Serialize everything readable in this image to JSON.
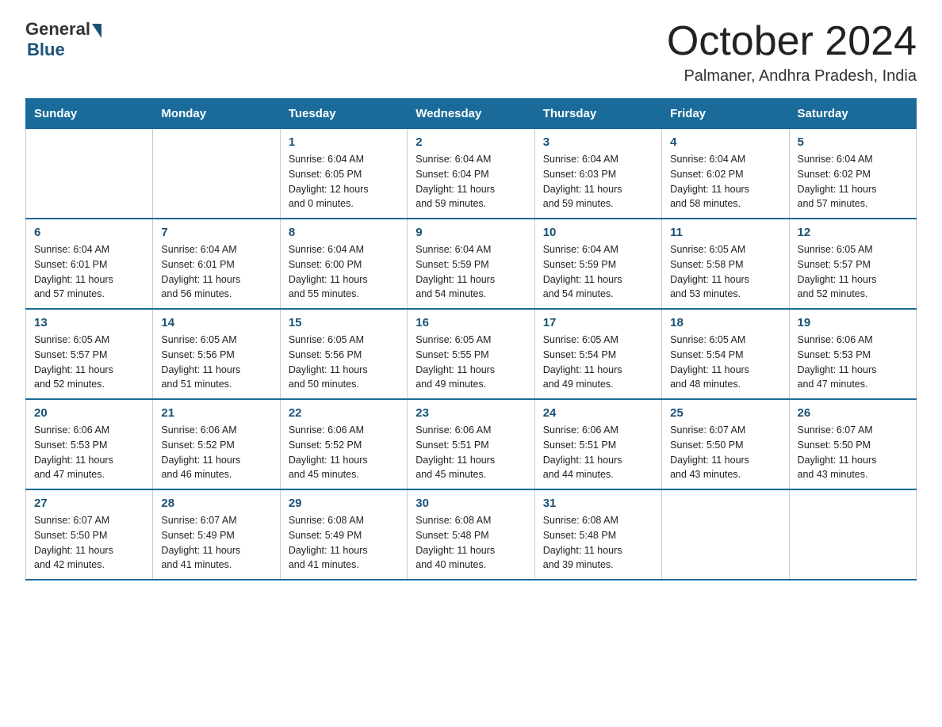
{
  "logo": {
    "general": "General",
    "blue": "Blue"
  },
  "title": "October 2024",
  "subtitle": "Palmaner, Andhra Pradesh, India",
  "headers": [
    "Sunday",
    "Monday",
    "Tuesday",
    "Wednesday",
    "Thursday",
    "Friday",
    "Saturday"
  ],
  "weeks": [
    [
      {
        "day": "",
        "info": ""
      },
      {
        "day": "",
        "info": ""
      },
      {
        "day": "1",
        "info": "Sunrise: 6:04 AM\nSunset: 6:05 PM\nDaylight: 12 hours\nand 0 minutes."
      },
      {
        "day": "2",
        "info": "Sunrise: 6:04 AM\nSunset: 6:04 PM\nDaylight: 11 hours\nand 59 minutes."
      },
      {
        "day": "3",
        "info": "Sunrise: 6:04 AM\nSunset: 6:03 PM\nDaylight: 11 hours\nand 59 minutes."
      },
      {
        "day": "4",
        "info": "Sunrise: 6:04 AM\nSunset: 6:02 PM\nDaylight: 11 hours\nand 58 minutes."
      },
      {
        "day": "5",
        "info": "Sunrise: 6:04 AM\nSunset: 6:02 PM\nDaylight: 11 hours\nand 57 minutes."
      }
    ],
    [
      {
        "day": "6",
        "info": "Sunrise: 6:04 AM\nSunset: 6:01 PM\nDaylight: 11 hours\nand 57 minutes."
      },
      {
        "day": "7",
        "info": "Sunrise: 6:04 AM\nSunset: 6:01 PM\nDaylight: 11 hours\nand 56 minutes."
      },
      {
        "day": "8",
        "info": "Sunrise: 6:04 AM\nSunset: 6:00 PM\nDaylight: 11 hours\nand 55 minutes."
      },
      {
        "day": "9",
        "info": "Sunrise: 6:04 AM\nSunset: 5:59 PM\nDaylight: 11 hours\nand 54 minutes."
      },
      {
        "day": "10",
        "info": "Sunrise: 6:04 AM\nSunset: 5:59 PM\nDaylight: 11 hours\nand 54 minutes."
      },
      {
        "day": "11",
        "info": "Sunrise: 6:05 AM\nSunset: 5:58 PM\nDaylight: 11 hours\nand 53 minutes."
      },
      {
        "day": "12",
        "info": "Sunrise: 6:05 AM\nSunset: 5:57 PM\nDaylight: 11 hours\nand 52 minutes."
      }
    ],
    [
      {
        "day": "13",
        "info": "Sunrise: 6:05 AM\nSunset: 5:57 PM\nDaylight: 11 hours\nand 52 minutes."
      },
      {
        "day": "14",
        "info": "Sunrise: 6:05 AM\nSunset: 5:56 PM\nDaylight: 11 hours\nand 51 minutes."
      },
      {
        "day": "15",
        "info": "Sunrise: 6:05 AM\nSunset: 5:56 PM\nDaylight: 11 hours\nand 50 minutes."
      },
      {
        "day": "16",
        "info": "Sunrise: 6:05 AM\nSunset: 5:55 PM\nDaylight: 11 hours\nand 49 minutes."
      },
      {
        "day": "17",
        "info": "Sunrise: 6:05 AM\nSunset: 5:54 PM\nDaylight: 11 hours\nand 49 minutes."
      },
      {
        "day": "18",
        "info": "Sunrise: 6:05 AM\nSunset: 5:54 PM\nDaylight: 11 hours\nand 48 minutes."
      },
      {
        "day": "19",
        "info": "Sunrise: 6:06 AM\nSunset: 5:53 PM\nDaylight: 11 hours\nand 47 minutes."
      }
    ],
    [
      {
        "day": "20",
        "info": "Sunrise: 6:06 AM\nSunset: 5:53 PM\nDaylight: 11 hours\nand 47 minutes."
      },
      {
        "day": "21",
        "info": "Sunrise: 6:06 AM\nSunset: 5:52 PM\nDaylight: 11 hours\nand 46 minutes."
      },
      {
        "day": "22",
        "info": "Sunrise: 6:06 AM\nSunset: 5:52 PM\nDaylight: 11 hours\nand 45 minutes."
      },
      {
        "day": "23",
        "info": "Sunrise: 6:06 AM\nSunset: 5:51 PM\nDaylight: 11 hours\nand 45 minutes."
      },
      {
        "day": "24",
        "info": "Sunrise: 6:06 AM\nSunset: 5:51 PM\nDaylight: 11 hours\nand 44 minutes."
      },
      {
        "day": "25",
        "info": "Sunrise: 6:07 AM\nSunset: 5:50 PM\nDaylight: 11 hours\nand 43 minutes."
      },
      {
        "day": "26",
        "info": "Sunrise: 6:07 AM\nSunset: 5:50 PM\nDaylight: 11 hours\nand 43 minutes."
      }
    ],
    [
      {
        "day": "27",
        "info": "Sunrise: 6:07 AM\nSunset: 5:50 PM\nDaylight: 11 hours\nand 42 minutes."
      },
      {
        "day": "28",
        "info": "Sunrise: 6:07 AM\nSunset: 5:49 PM\nDaylight: 11 hours\nand 41 minutes."
      },
      {
        "day": "29",
        "info": "Sunrise: 6:08 AM\nSunset: 5:49 PM\nDaylight: 11 hours\nand 41 minutes."
      },
      {
        "day": "30",
        "info": "Sunrise: 6:08 AM\nSunset: 5:48 PM\nDaylight: 11 hours\nand 40 minutes."
      },
      {
        "day": "31",
        "info": "Sunrise: 6:08 AM\nSunset: 5:48 PM\nDaylight: 11 hours\nand 39 minutes."
      },
      {
        "day": "",
        "info": ""
      },
      {
        "day": "",
        "info": ""
      }
    ]
  ]
}
